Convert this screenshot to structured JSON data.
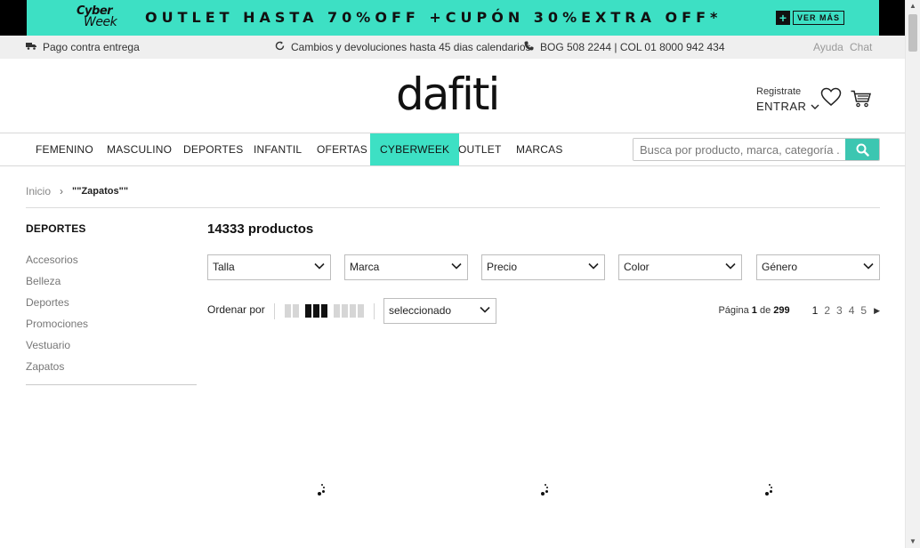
{
  "promo": {
    "logo_line1": "Cyber",
    "logo_line2": "Week",
    "text": "OUTLET HASTA 70%OFF +CUPÓN 30%EXTRA OFF*",
    "cta": "VER MÁS",
    "bg_color": "#3de0c4"
  },
  "infobar": {
    "delivery": "Pago contra entrega",
    "returns": "Cambios y devoluciones hasta 45 dias calendarios",
    "phone": "BOG 508 2244 | COL 01 8000 942 434",
    "help": "Ayuda",
    "chat": "Chat"
  },
  "header": {
    "logo": "dafiti",
    "register": "Registrate",
    "login": "ENTRAR"
  },
  "nav": {
    "tabs": [
      "FEMENINO",
      "MASCULINO",
      "DEPORTES",
      "INFANTIL",
      "OFERTAS",
      "CYBERWEEK",
      "OUTLET",
      "MARCAS"
    ],
    "active_tab": "CYBERWEEK",
    "search_placeholder": "Busca por producto, marca, categoría ..."
  },
  "breadcrumb": {
    "home": "Inicio",
    "current": "\"\"Zapatos\"\""
  },
  "sidebar": {
    "title": "DEPORTES",
    "categories": [
      "Accesorios",
      "Belleza",
      "Deportes",
      "Promociones",
      "Vestuario",
      "Zapatos"
    ]
  },
  "products": {
    "count_label": "14333 productos",
    "filters": [
      "Talla",
      "Marca",
      "Precio",
      "Color",
      "Género"
    ],
    "sort_label": "Ordenar por",
    "sort_value": "seleccionado",
    "pagination": {
      "prefix": "Página",
      "current": "1",
      "of": "de",
      "total": "299",
      "pages": [
        "1",
        "2",
        "3",
        "4",
        "5"
      ]
    }
  },
  "colors": {
    "accent": "#3de0c4",
    "search_button": "#3cc6b1"
  }
}
